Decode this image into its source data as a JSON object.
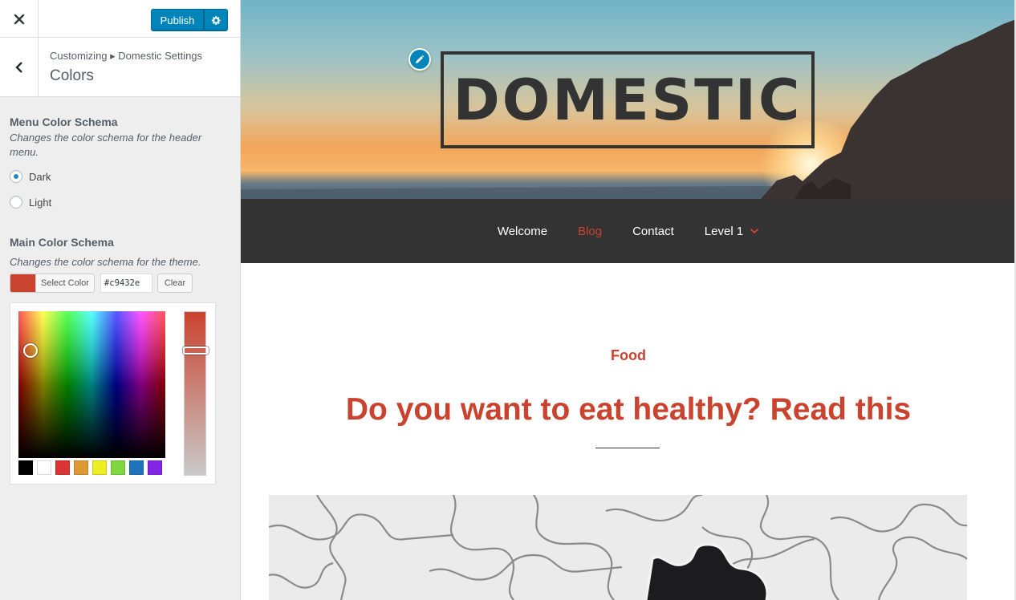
{
  "customizer": {
    "publish_label": "Publish",
    "breadcrumb": "Customizing ▸ Domestic Settings",
    "section_title": "Colors"
  },
  "menu_color": {
    "title": "Menu Color Schema",
    "description": "Changes the color schema for the header menu.",
    "options": [
      {
        "label": "Dark",
        "checked": true
      },
      {
        "label": "Light",
        "checked": false
      }
    ]
  },
  "main_color": {
    "title": "Main Color Schema",
    "description": "Changes the color schema for the theme.",
    "select_label": "Select Color",
    "hex_value": "#c9432e",
    "clear_label": "Clear",
    "current_color": "#c9432e",
    "palette": [
      "#000000",
      "#ffffff",
      "#dd3333",
      "#dd9933",
      "#eeee22",
      "#81d742",
      "#1e73be",
      "#8224e3"
    ]
  },
  "preview": {
    "site_title": "DOMESTIC",
    "nav": [
      {
        "label": "Welcome",
        "active": false
      },
      {
        "label": "Blog",
        "active": true
      },
      {
        "label": "Contact",
        "active": false
      },
      {
        "label": "Level 1",
        "active": false,
        "has_dropdown": true
      }
    ],
    "post": {
      "category": "Food",
      "title": "Do you want to eat healthy? Read this"
    }
  }
}
